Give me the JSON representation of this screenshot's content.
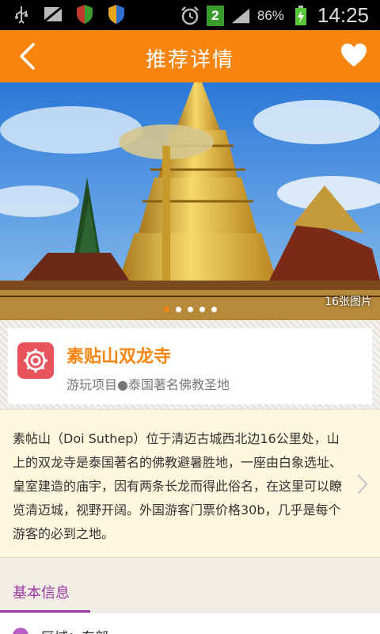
{
  "status_bar": {
    "icons_left": [
      "usb-icon",
      "no-sim-icon",
      "shield-icon",
      "shield-icon"
    ],
    "notification_count": "2",
    "battery": "86%",
    "time": "14:25"
  },
  "header": {
    "title": "推荐详情",
    "back_icon": "chevron-left-icon",
    "favorite_icon": "heart-icon"
  },
  "hero": {
    "photo_count": "16张图片",
    "dots_total": 5,
    "active_dot": 0
  },
  "place": {
    "name": "素贴山双龙寺",
    "subtitle": "游玩项目●泰国著名佛教圣地",
    "icon": "settings-icon"
  },
  "description": {
    "text": "素帖山（Doi Suthep）位于清迈古城西北边16公里处，山上的双龙寺是泰国著名的佛教避暑胜地，一座由白象选址、皇室建造的庙宇，因有两条长龙而得此俗名，在这里可以瞭览清迈城，视野开阔。外国游客门票价格30b，几乎是每个游客的必到之地。"
  },
  "section": {
    "tab_label": "基本信息",
    "row_label": "区域：东部"
  },
  "colors": {
    "accent": "#f7850f",
    "purple": "#9b3aa0",
    "icon_red": "#e8545b"
  }
}
